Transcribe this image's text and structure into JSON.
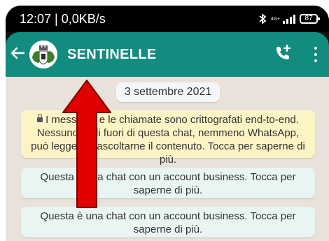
{
  "status_bar": {
    "time_data": "12:07 | 0,0KB/s",
    "network_type": "4G+",
    "battery": "87"
  },
  "header": {
    "title": "SENTINELLE",
    "back_icon": "arrow-left-icon",
    "avatar_icon": "coat-of-arms",
    "call_icon": "add-call-icon",
    "menu_icon": "more-vertical-icon"
  },
  "chat": {
    "date": "3 settembre 2021",
    "encryption_notice": "I messaggi e le chiamate sono crittografati end-to-end. Nessuno al di fuori di questa chat, nemmeno WhatsApp, può leggerli o ascoltarne il contenuto. Tocca per saperne di più.",
    "business_notice_1": "Questa è una chat con un account business. Tocca per saperne di più.",
    "business_notice_2": "Questa è una chat con un account business. Tocca per saperne di più."
  },
  "annotation": {
    "arrow_color": "#e00000"
  },
  "colors": {
    "header": "#128c7e",
    "chat_background": "#e9e2da",
    "encryption_bubble": "#fdf4c5",
    "business_bubble": "#e9f5f3"
  }
}
